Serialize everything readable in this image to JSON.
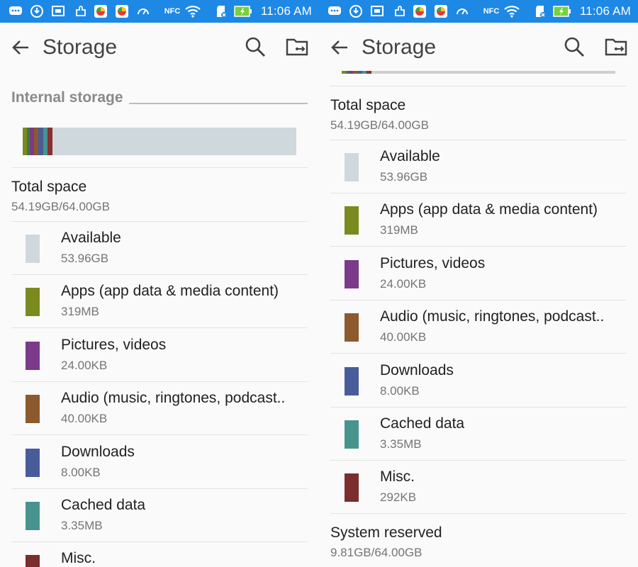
{
  "status_bar": {
    "time": "11:06 AM",
    "icons": [
      "chat-icon",
      "download-icon",
      "screenshot-icon",
      "puzzle-icon",
      "app-icon",
      "app-icon",
      "speedometer-icon",
      "nfc-icon",
      "wifi-icon",
      "sd-card-icon",
      "battery-charging-icon"
    ],
    "nfc_text": "NFC",
    "background_color": "#1e88e5",
    "battery_color": "#76d13a"
  },
  "action_bar": {
    "title": "Storage",
    "back_icon": "arrow-left-icon",
    "search_icon": "search-icon",
    "folder_icon": "usb-folder-icon"
  },
  "section": {
    "title": "Internal storage"
  },
  "usage_bar": {
    "background_color": "#cfd8dc",
    "segments": [
      {
        "color": "#7a8a1f",
        "fraction": 0.016
      },
      {
        "color": "#3d7a40",
        "fraction": 0.01
      },
      {
        "color": "#7b3a8a",
        "fraction": 0.016
      },
      {
        "color": "#8c5a2e",
        "fraction": 0.016
      },
      {
        "color": "#485c9a",
        "fraction": 0.016
      },
      {
        "color": "#47948f",
        "fraction": 0.016
      },
      {
        "color": "#8a2e2e",
        "fraction": 0.02
      }
    ]
  },
  "total_space": {
    "label": "Total space",
    "value": "54.19GB/64.00GB"
  },
  "categories": [
    {
      "label": "Available",
      "value": "53.96GB",
      "color": "#cfd8dc"
    },
    {
      "label": "Apps (app data & media content)",
      "value": "319MB",
      "color": "#7a8a1f"
    },
    {
      "label": "Pictures, videos",
      "value": "24.00KB",
      "color": "#7b3a8a"
    },
    {
      "label": "Audio (music, ringtones, podcast..",
      "value": "40.00KB",
      "color": "#8c5a2e"
    },
    {
      "label": "Downloads",
      "value": "8.00KB",
      "color": "#485c9a"
    },
    {
      "label": "Cached data",
      "value": "3.35MB",
      "color": "#47948f"
    },
    {
      "label": "Misc.",
      "value": "292KB",
      "color": "#7a2e2e"
    }
  ],
  "system_reserved": {
    "label": "System reserved",
    "value": "9.81GB/64.00GB"
  }
}
